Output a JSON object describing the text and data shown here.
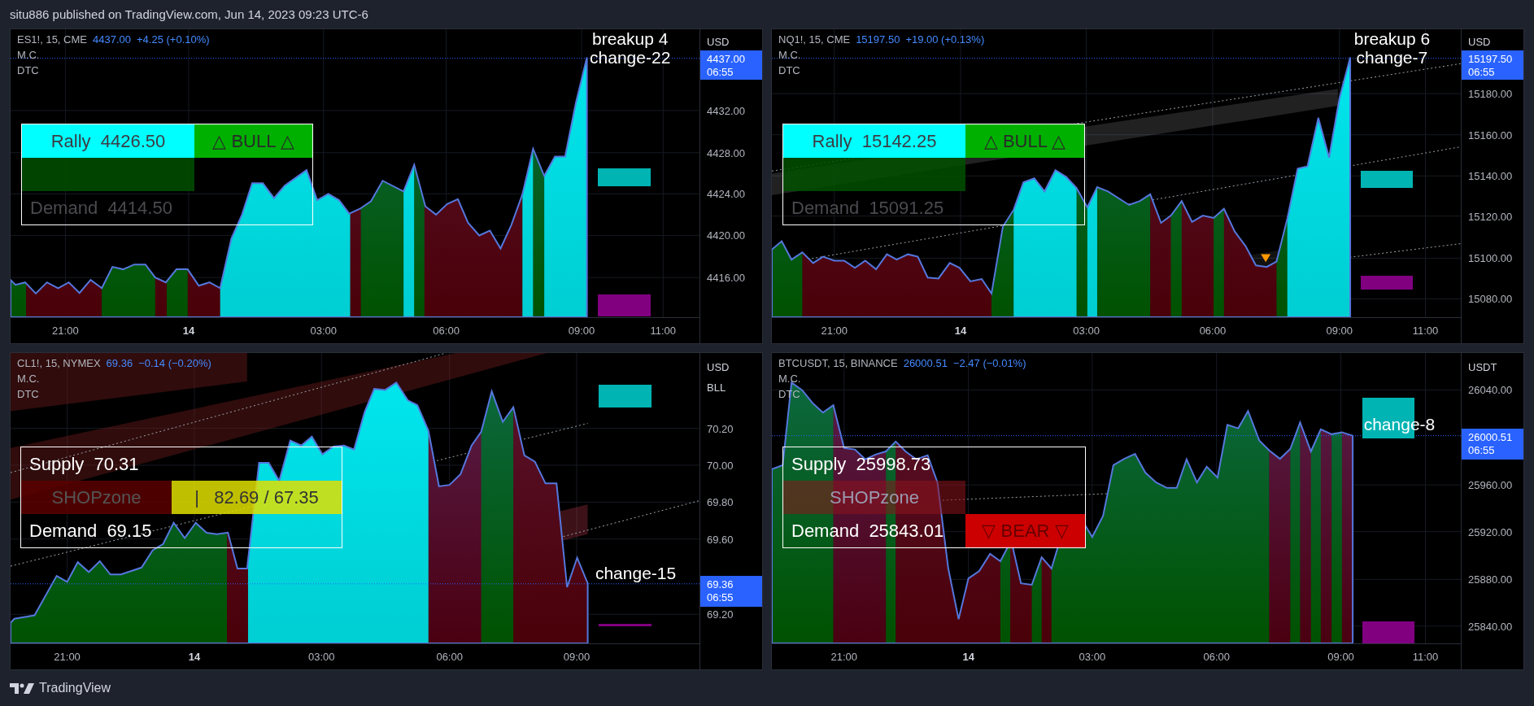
{
  "byline": "situ886 published on TradingView.com, Jun 14, 2023 09:23 UTC-6",
  "charts": [
    {
      "symbol": "ES1!, 15, CME",
      "price": "4437.00",
      "change": "+4.25 (+0.10%)",
      "indicators": [
        "M.C.",
        "DTC"
      ],
      "axis_units": [
        "USD"
      ],
      "y_ticks": [
        "4432.00",
        "4428.00",
        "4424.00",
        "4420.00",
        "4416.00"
      ],
      "price_tag": {
        "price": "4437.00",
        "timer": "06:55"
      },
      "x_ticks": [
        {
          "label": "21:00",
          "bold": false
        },
        {
          "label": "14",
          "bold": true
        },
        {
          "label": "03:00",
          "bold": false
        },
        {
          "label": "06:00",
          "bold": false
        },
        {
          "label": "09:00",
          "bold": false
        },
        {
          "label": "11:00",
          "bold": false
        }
      ],
      "annotations": [
        "breakup 4",
        "change-22"
      ],
      "table": [
        [
          {
            "kind": "rally",
            "text": "Rally  4426.50"
          },
          {
            "kind": "bull",
            "text": "△ BULL △"
          }
        ],
        [
          {
            "kind": "fill"
          },
          {
            "kind": "blank"
          }
        ],
        [
          {
            "kind": "dim",
            "text": "Demand  4414.50"
          },
          {
            "kind": "blank"
          }
        ]
      ]
    },
    {
      "symbol": "NQ1!, 15, CME",
      "price": "15197.50",
      "change": "+19.00 (+0.13%)",
      "indicators": [
        "M.C.",
        "DTC"
      ],
      "axis_units": [
        "USD"
      ],
      "y_ticks": [
        "15180.00",
        "15160.00",
        "15140.00",
        "15120.00",
        "15100.00",
        "15080.00"
      ],
      "price_tag": {
        "price": "15197.50",
        "timer": "06:55"
      },
      "x_ticks": [
        {
          "label": "21:00",
          "bold": false
        },
        {
          "label": "14",
          "bold": true
        },
        {
          "label": "03:00",
          "bold": false
        },
        {
          "label": "06:00",
          "bold": false
        },
        {
          "label": "09:00",
          "bold": false
        },
        {
          "label": "11:00",
          "bold": false
        }
      ],
      "annotations": [
        "breakup 6",
        "change-7"
      ],
      "table": [
        [
          {
            "kind": "rally",
            "text": "Rally  15142.25"
          },
          {
            "kind": "bull",
            "text": "△ BULL △"
          }
        ],
        [
          {
            "kind": "fill"
          },
          {
            "kind": "blank"
          }
        ],
        [
          {
            "kind": "dim",
            "text": "Demand  15091.25"
          },
          {
            "kind": "blank"
          }
        ]
      ]
    },
    {
      "symbol": "CL1!, 15, NYMEX",
      "price": "69.36",
      "change": "−0.14 (−0.20%)",
      "indicators": [
        "M.C.",
        "DTC"
      ],
      "axis_units": [
        "USD",
        "BLL"
      ],
      "y_ticks": [
        "70.20",
        "70.00",
        "69.80",
        "69.60",
        "69.20"
      ],
      "price_tag": {
        "price": "69.36",
        "timer": "06:55"
      },
      "x_ticks": [
        {
          "label": "21:00",
          "bold": false
        },
        {
          "label": "14",
          "bold": true
        },
        {
          "label": "03:00",
          "bold": false
        },
        {
          "label": "06:00",
          "bold": false
        },
        {
          "label": "09:00",
          "bold": false
        }
      ],
      "annotations": [
        "change-15"
      ],
      "table": [
        [
          {
            "kind": "plain",
            "text": "Supply  70.31"
          },
          {
            "kind": "blank"
          }
        ],
        [
          {
            "kind": "shop",
            "text": "SHOPzone"
          },
          {
            "kind": "range",
            "text": "|   82.69 / 67.35"
          }
        ],
        [
          {
            "kind": "plain",
            "text": "Demand  69.15"
          },
          {
            "kind": "blank"
          }
        ]
      ]
    },
    {
      "symbol": "BTCUSDT, 15, BINANCE",
      "price": "26000.51",
      "change": "−2.47 (−0.01%)",
      "indicators": [
        "M.C.",
        "DTC"
      ],
      "axis_units": [
        "USDT"
      ],
      "y_ticks": [
        "26040.00",
        "25960.00",
        "25920.00",
        "25880.00",
        "25840.00"
      ],
      "price_tag": {
        "price": "26000.51",
        "timer": "06:55"
      },
      "x_ticks": [
        {
          "label": "21:00",
          "bold": false
        },
        {
          "label": "14",
          "bold": true
        },
        {
          "label": "03:00",
          "bold": false
        },
        {
          "label": "06:00",
          "bold": false
        },
        {
          "label": "09:00",
          "bold": false
        },
        {
          "label": "11:00",
          "bold": false
        }
      ],
      "annotations": [
        "change-8"
      ],
      "table": [
        [
          {
            "kind": "plain",
            "text": "Supply  25998.73"
          },
          {
            "kind": "blank"
          }
        ],
        [
          {
            "kind": "zone",
            "text": "SHOPzone"
          },
          {
            "kind": "blank"
          }
        ],
        [
          {
            "kind": "plain",
            "text": "Demand  25843.01"
          },
          {
            "kind": "bear",
            "text": "▽ BEAR ▽"
          }
        ]
      ]
    }
  ],
  "footer": {
    "brand": "TradingView"
  }
}
